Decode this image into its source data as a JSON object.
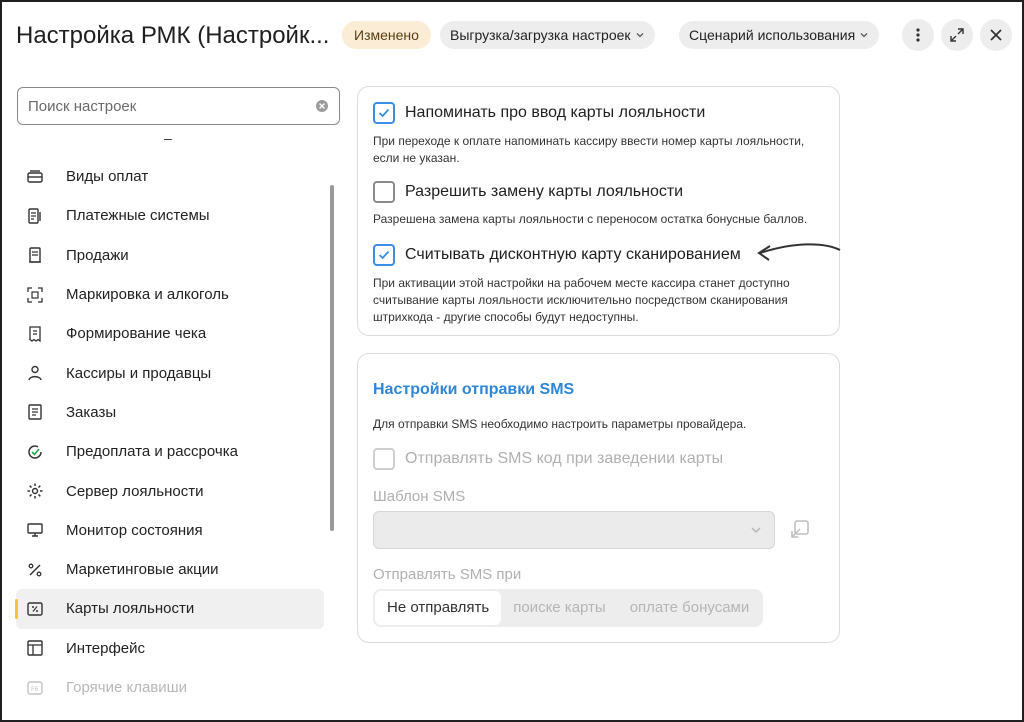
{
  "header": {
    "title": "Настройка РМК (Настройк...",
    "changed_badge": "Изменено",
    "export_menu": "Выгрузка/загрузка настроек",
    "scenario_menu": "Сценарий использования",
    "more_icon": "more-vertical-icon",
    "expand_icon": "expand-icon",
    "close_icon": "close-icon"
  },
  "sidebar": {
    "search_placeholder": "Поиск настроек",
    "collapse_mark": "–",
    "items": [
      {
        "label": "Виды оплат",
        "icon": "payment-types-icon"
      },
      {
        "label": "Платежные системы",
        "icon": "payment-systems-icon"
      },
      {
        "label": "Продажи",
        "icon": "sales-icon"
      },
      {
        "label": "Маркировка и алкоголь",
        "icon": "marking-icon"
      },
      {
        "label": "Формирование чека",
        "icon": "receipt-icon"
      },
      {
        "label": "Кассиры и продавцы",
        "icon": "cashier-icon"
      },
      {
        "label": "Заказы",
        "icon": "orders-icon"
      },
      {
        "label": "Предоплата и рассрочка",
        "icon": "prepayment-icon"
      },
      {
        "label": "Сервер лояльности",
        "icon": "gear-icon"
      },
      {
        "label": "Монитор состояния",
        "icon": "monitor-icon"
      },
      {
        "label": "Маркетинговые акции",
        "icon": "percent-icon"
      },
      {
        "label": "Карты лояльности",
        "icon": "loyalty-card-icon"
      },
      {
        "label": "Интерфейс",
        "icon": "interface-icon"
      },
      {
        "label": "Горячие клавиши",
        "icon": "hotkeys-icon"
      }
    ],
    "active_index": 11
  },
  "loyalty": {
    "remind": {
      "label": "Напоминать про ввод карты лояльности",
      "checked": true,
      "hint": "При переходе к оплате напоминать кассиру ввести номер карты лояльности, если не указан."
    },
    "allow_replace": {
      "label": "Разрешить замену карты лояльности",
      "checked": false,
      "hint": "Разрешена замена карты лояльности с переносом остатка бонусные баллов."
    },
    "scan_only": {
      "label": "Считывать дисконтную карту сканированием",
      "checked": true,
      "hint": "При активации этой настройки на рабочем месте кассира станет доступно считывание карты лояльности исключительно посредством сканирования штрихкода - другие способы будут недоступны."
    }
  },
  "sms": {
    "title": "Настройки отправки SMS",
    "description": "Для отправки SMS необходимо настроить параметры провайдера.",
    "send_code": {
      "label": "Отправлять SMS код при заведении карты",
      "checked": false
    },
    "template_label": "Шаблон SMS",
    "template_value": "",
    "send_when_label": "Отправлять SMS при",
    "send_when_options": [
      "Не отправлять",
      "поиске карты",
      "оплате бонусами"
    ],
    "send_when_selected": 0
  },
  "colors": {
    "accent": "#3a8ee6",
    "badge_bg": "#fbecd6",
    "active_marker": "#f5c23c"
  }
}
